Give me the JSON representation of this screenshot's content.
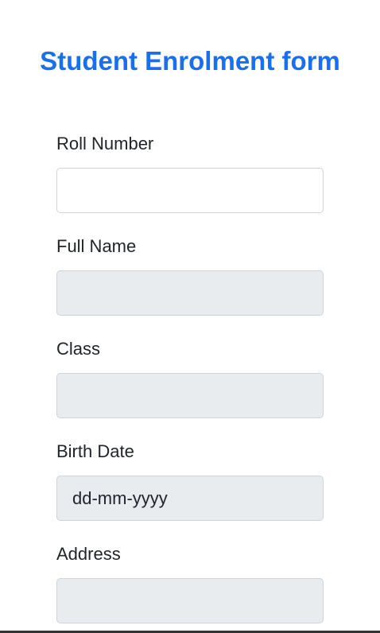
{
  "form": {
    "title": "Student Enrolment form"
  },
  "fields": {
    "roll_number": {
      "label": "Roll Number",
      "value": ""
    },
    "full_name": {
      "label": "Full Name",
      "value": ""
    },
    "class": {
      "label": "Class",
      "value": ""
    },
    "birth_date": {
      "label": "Birth Date",
      "placeholder": "dd-mm-yyyy"
    },
    "address": {
      "label": "Address",
      "value": ""
    }
  },
  "colors": {
    "title": "#1a6ef0",
    "input_disabled_bg": "#e9ecef",
    "input_border": "#ced4da",
    "text": "#212529"
  }
}
